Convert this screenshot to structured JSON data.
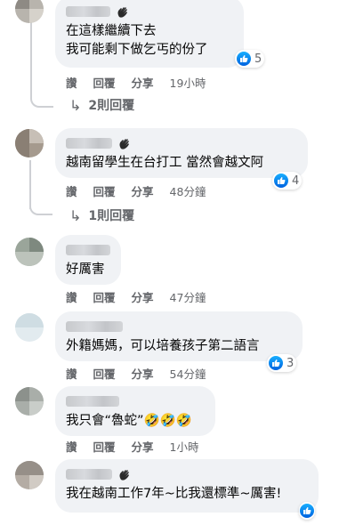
{
  "comments": [
    {
      "lines": "在這樣繼續下去\n我可能剩下做乞丐的份了",
      "has_wave": true,
      "reactions": "5",
      "actions": {
        "like": "讚",
        "reply": "回覆",
        "share": "分享",
        "time": "19小時"
      },
      "replies_label": "2則回覆"
    },
    {
      "lines": "越南留學生在台打工 當然會越文阿",
      "has_wave": true,
      "reactions": "4",
      "actions": {
        "like": "讚",
        "reply": "回覆",
        "share": "分享",
        "time": "48分鐘"
      },
      "replies_label": "1則回覆"
    },
    {
      "lines": "好厲害",
      "has_wave": false,
      "actions": {
        "like": "讚",
        "reply": "回覆",
        "share": "分享",
        "time": "47分鐘"
      }
    },
    {
      "lines": "外籍媽媽，可以培養孩子第二語言",
      "has_wave": false,
      "reactions": "3",
      "actions": {
        "like": "讚",
        "reply": "回覆",
        "share": "分享",
        "time": "54分鐘"
      }
    },
    {
      "lines": "我只會“魯蛇”",
      "has_wave": false,
      "emoji": "🤣🤣🤣",
      "actions": {
        "like": "讚",
        "reply": "回覆",
        "share": "分享",
        "time": "1小時"
      }
    },
    {
      "lines": "我在越南工作7年~比我還標準~厲害!",
      "has_wave": true,
      "reactions": "",
      "actions": {}
    }
  ],
  "colors": {
    "bubble": "#f0f2f5",
    "like_blue": "#1877f2",
    "meta_text": "#65676b"
  },
  "icons": {
    "wave": "waving-hand-icon",
    "like": "like-thumb-icon",
    "reply_arrow": "reply-arrow-icon"
  }
}
